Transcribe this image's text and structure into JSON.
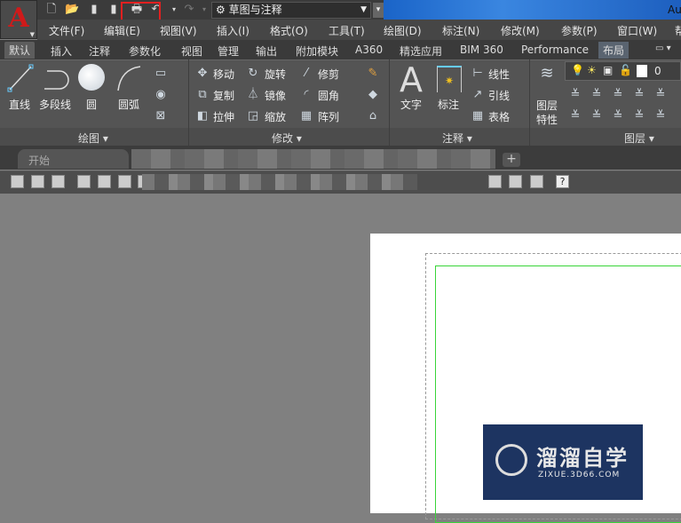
{
  "title_bar": {
    "workspace": "草图与注释",
    "app_title_partial": "Au",
    "highlight_color": "#e32020"
  },
  "menu_bar": [
    "文件(F)",
    "编辑(E)",
    "视图(V)",
    "插入(I)",
    "格式(O)",
    "工具(T)",
    "绘图(D)",
    "标注(N)",
    "修改(M)",
    "参数(P)",
    "窗口(W)",
    "帮"
  ],
  "ribbon_tabs": [
    "默认",
    "插入",
    "注释",
    "参数化",
    "视图",
    "管理",
    "输出",
    "附加模块",
    "A360",
    "精选应用",
    "BIM 360",
    "Performance",
    "布局"
  ],
  "ribbon": {
    "draw": {
      "title": "绘图",
      "line": "直线",
      "polyline": "多段线",
      "circle": "圆",
      "arc": "圆弧"
    },
    "modify": {
      "title": "修改",
      "move": "移动",
      "rotate": "旋转",
      "trim": "修剪",
      "copy": "复制",
      "mirror": "镜像",
      "fillet": "圆角",
      "stretch": "拉伸",
      "scale": "缩放",
      "array": "阵列"
    },
    "annotation": {
      "title": "注释",
      "text": "文字",
      "dimension": "标注",
      "linear": "线性",
      "leader": "引线",
      "table": "表格"
    },
    "layers": {
      "title": "图层",
      "properties_line1": "图层",
      "properties_line2": "特性",
      "current_layer": "0"
    }
  },
  "file_tabs": {
    "start": "开始",
    "plus": "+"
  },
  "watermark": {
    "name": "溜溜自学",
    "url": "ZIXUE.3D66.COM"
  }
}
